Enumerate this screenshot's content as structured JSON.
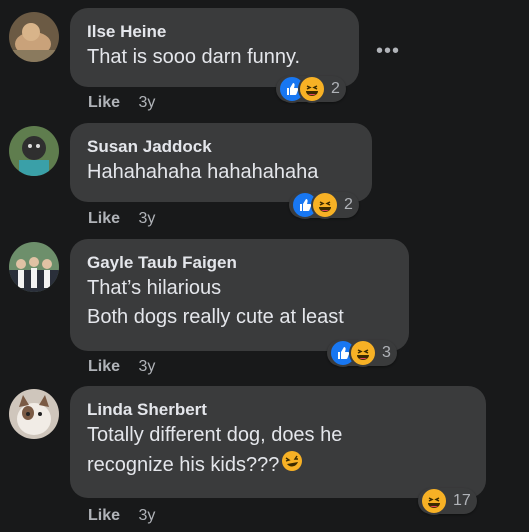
{
  "comments": [
    {
      "author": "Ilse Heine",
      "lines": [
        "That is sooo darn funny."
      ],
      "like": "Like",
      "time": "3y",
      "reactions": [
        "like-icon",
        "haha-icon"
      ],
      "count": "2"
    },
    {
      "author": "Susan Jaddock",
      "lines": [
        "Hahahahaha hahahahaha"
      ],
      "like": "Like",
      "time": "3y",
      "reactions": [
        "like-icon",
        "haha-icon"
      ],
      "count": "2"
    },
    {
      "author": "Gayle Taub Faigen",
      "lines": [
        "That’s hilarious",
        "Both dogs really cute at least"
      ],
      "like": "Like",
      "time": "3y",
      "reactions": [
        "like-icon",
        "haha-icon"
      ],
      "count": "3"
    },
    {
      "author": "Linda Sherbert",
      "lines": [
        "Totally different dog, does he",
        "recognize his kids???"
      ],
      "like": "Like",
      "time": "3y",
      "reactions": [
        "haha-icon"
      ],
      "count": "17"
    }
  ],
  "more_icon": "more-horizontal-icon",
  "more_glyph": "•••",
  "colors": {
    "background": "#18191a",
    "bubble": "#3a3b3c",
    "text": "#e4e6eb",
    "secondary": "#b0b3b8",
    "like_blue": "#1877f2",
    "haha_yellow": "#f7b125"
  }
}
